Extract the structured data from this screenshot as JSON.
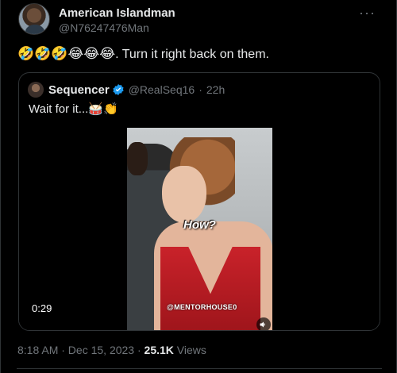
{
  "tweet": {
    "author_name": "American Islandman",
    "author_handle": "@N76247476Man",
    "more_icon": "more-horizontal-icon",
    "emojis": "🤣🤣🤣😂😂😂",
    "text": ". Turn it right back on them."
  },
  "quoted": {
    "author_name": "Sequencer",
    "verified_icon": "verified-badge-icon",
    "verified_color": "#1d9bf0",
    "author_handle": "@RealSeq16",
    "separator": "·",
    "time": "22h",
    "text": "Wait for it...",
    "text_emojis": "🥁👏",
    "video": {
      "overlay_text": "How?",
      "watermark": "@MENTORHOUSE0",
      "duration": "0:29",
      "mute_icon": "speaker-icon"
    }
  },
  "meta": {
    "timestamp": "8:18 AM · Dec 15, 2023 ·",
    "views_count": "25.1K",
    "views_label": "Views"
  }
}
